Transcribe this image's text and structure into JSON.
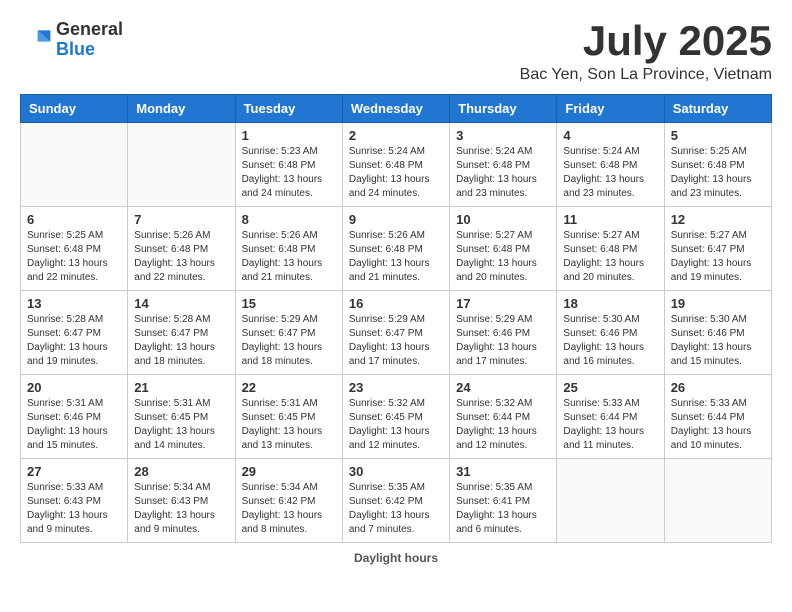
{
  "header": {
    "logo_general": "General",
    "logo_blue": "Blue",
    "month_title": "July 2025",
    "location": "Bac Yen, Son La Province, Vietnam"
  },
  "days_of_week": [
    "Sunday",
    "Monday",
    "Tuesday",
    "Wednesday",
    "Thursday",
    "Friday",
    "Saturday"
  ],
  "weeks": [
    [
      {
        "day": "",
        "info": ""
      },
      {
        "day": "",
        "info": ""
      },
      {
        "day": "1",
        "info": "Sunrise: 5:23 AM\nSunset: 6:48 PM\nDaylight: 13 hours and 24 minutes."
      },
      {
        "day": "2",
        "info": "Sunrise: 5:24 AM\nSunset: 6:48 PM\nDaylight: 13 hours and 24 minutes."
      },
      {
        "day": "3",
        "info": "Sunrise: 5:24 AM\nSunset: 6:48 PM\nDaylight: 13 hours and 23 minutes."
      },
      {
        "day": "4",
        "info": "Sunrise: 5:24 AM\nSunset: 6:48 PM\nDaylight: 13 hours and 23 minutes."
      },
      {
        "day": "5",
        "info": "Sunrise: 5:25 AM\nSunset: 6:48 PM\nDaylight: 13 hours and 23 minutes."
      }
    ],
    [
      {
        "day": "6",
        "info": "Sunrise: 5:25 AM\nSunset: 6:48 PM\nDaylight: 13 hours and 22 minutes."
      },
      {
        "day": "7",
        "info": "Sunrise: 5:26 AM\nSunset: 6:48 PM\nDaylight: 13 hours and 22 minutes."
      },
      {
        "day": "8",
        "info": "Sunrise: 5:26 AM\nSunset: 6:48 PM\nDaylight: 13 hours and 21 minutes."
      },
      {
        "day": "9",
        "info": "Sunrise: 5:26 AM\nSunset: 6:48 PM\nDaylight: 13 hours and 21 minutes."
      },
      {
        "day": "10",
        "info": "Sunrise: 5:27 AM\nSunset: 6:48 PM\nDaylight: 13 hours and 20 minutes."
      },
      {
        "day": "11",
        "info": "Sunrise: 5:27 AM\nSunset: 6:48 PM\nDaylight: 13 hours and 20 minutes."
      },
      {
        "day": "12",
        "info": "Sunrise: 5:27 AM\nSunset: 6:47 PM\nDaylight: 13 hours and 19 minutes."
      }
    ],
    [
      {
        "day": "13",
        "info": "Sunrise: 5:28 AM\nSunset: 6:47 PM\nDaylight: 13 hours and 19 minutes."
      },
      {
        "day": "14",
        "info": "Sunrise: 5:28 AM\nSunset: 6:47 PM\nDaylight: 13 hours and 18 minutes."
      },
      {
        "day": "15",
        "info": "Sunrise: 5:29 AM\nSunset: 6:47 PM\nDaylight: 13 hours and 18 minutes."
      },
      {
        "day": "16",
        "info": "Sunrise: 5:29 AM\nSunset: 6:47 PM\nDaylight: 13 hours and 17 minutes."
      },
      {
        "day": "17",
        "info": "Sunrise: 5:29 AM\nSunset: 6:46 PM\nDaylight: 13 hours and 17 minutes."
      },
      {
        "day": "18",
        "info": "Sunrise: 5:30 AM\nSunset: 6:46 PM\nDaylight: 13 hours and 16 minutes."
      },
      {
        "day": "19",
        "info": "Sunrise: 5:30 AM\nSunset: 6:46 PM\nDaylight: 13 hours and 15 minutes."
      }
    ],
    [
      {
        "day": "20",
        "info": "Sunrise: 5:31 AM\nSunset: 6:46 PM\nDaylight: 13 hours and 15 minutes."
      },
      {
        "day": "21",
        "info": "Sunrise: 5:31 AM\nSunset: 6:45 PM\nDaylight: 13 hours and 14 minutes."
      },
      {
        "day": "22",
        "info": "Sunrise: 5:31 AM\nSunset: 6:45 PM\nDaylight: 13 hours and 13 minutes."
      },
      {
        "day": "23",
        "info": "Sunrise: 5:32 AM\nSunset: 6:45 PM\nDaylight: 13 hours and 12 minutes."
      },
      {
        "day": "24",
        "info": "Sunrise: 5:32 AM\nSunset: 6:44 PM\nDaylight: 13 hours and 12 minutes."
      },
      {
        "day": "25",
        "info": "Sunrise: 5:33 AM\nSunset: 6:44 PM\nDaylight: 13 hours and 11 minutes."
      },
      {
        "day": "26",
        "info": "Sunrise: 5:33 AM\nSunset: 6:44 PM\nDaylight: 13 hours and 10 minutes."
      }
    ],
    [
      {
        "day": "27",
        "info": "Sunrise: 5:33 AM\nSunset: 6:43 PM\nDaylight: 13 hours and 9 minutes."
      },
      {
        "day": "28",
        "info": "Sunrise: 5:34 AM\nSunset: 6:43 PM\nDaylight: 13 hours and 9 minutes."
      },
      {
        "day": "29",
        "info": "Sunrise: 5:34 AM\nSunset: 6:42 PM\nDaylight: 13 hours and 8 minutes."
      },
      {
        "day": "30",
        "info": "Sunrise: 5:35 AM\nSunset: 6:42 PM\nDaylight: 13 hours and 7 minutes."
      },
      {
        "day": "31",
        "info": "Sunrise: 5:35 AM\nSunset: 6:41 PM\nDaylight: 13 hours and 6 minutes."
      },
      {
        "day": "",
        "info": ""
      },
      {
        "day": "",
        "info": ""
      }
    ]
  ],
  "footer": {
    "label": "Daylight hours"
  }
}
